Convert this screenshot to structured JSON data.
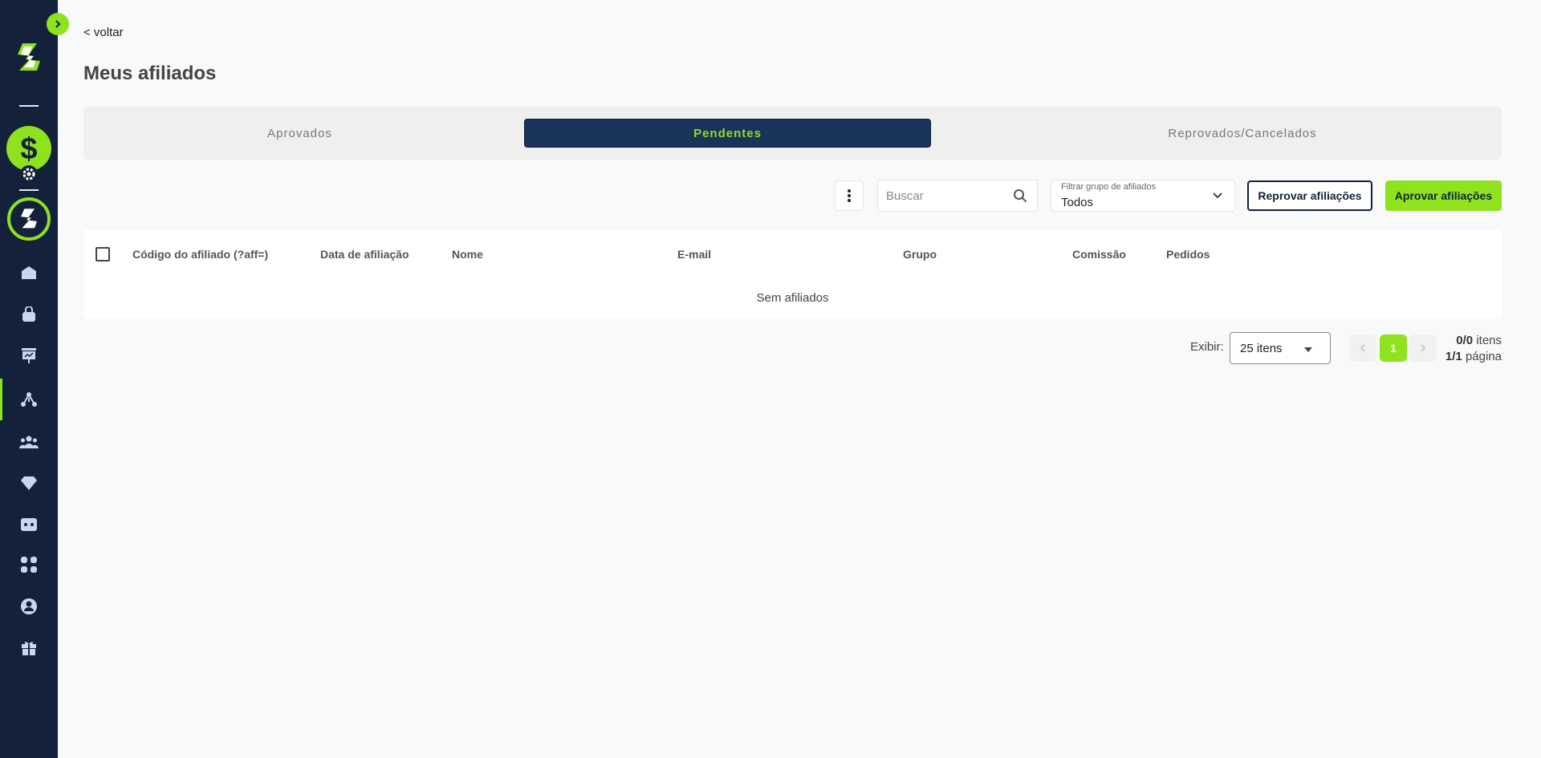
{
  "nav": {
    "back_label": "< voltar"
  },
  "page": {
    "title": "Meus afiliados"
  },
  "tabs": [
    {
      "label": "Aprovados",
      "active": false
    },
    {
      "label": "Pendentes",
      "active": true
    },
    {
      "label": "Reprovados/Cancelados",
      "active": false
    }
  ],
  "toolbar": {
    "search_placeholder": "Buscar",
    "filter_label": "Filtrar grupo de afiliados",
    "filter_value": "Todos",
    "reject_label": "Reprovar afiliações",
    "approve_label": "Aprovar afiliações"
  },
  "table": {
    "columns": [
      "Código do afiliado (?aff=)",
      "Data de afiliação",
      "Nome",
      "E-mail",
      "Grupo",
      "Comissão",
      "Pedidos"
    ],
    "empty_message": "Sem afiliados"
  },
  "pagination": {
    "show_label": "Exibir:",
    "per_page": "25 itens",
    "current_page": "1",
    "items_count": "0/0",
    "items_suffix": "itens",
    "pages_count": "1/1",
    "pages_suffix": "página"
  },
  "colors": {
    "accent": "#8ee21e",
    "sidebar": "#13213a",
    "active_tab": "#1a3359"
  },
  "sidebar_icons": [
    "dollar-icon",
    "gear-icon",
    "brand-logo-icon",
    "home-icon",
    "bag-icon",
    "presentation-icon",
    "affiliates-icon",
    "users-icon",
    "diamond-icon",
    "ticket-icon",
    "apps-icon",
    "account-icon",
    "gift-icon"
  ]
}
